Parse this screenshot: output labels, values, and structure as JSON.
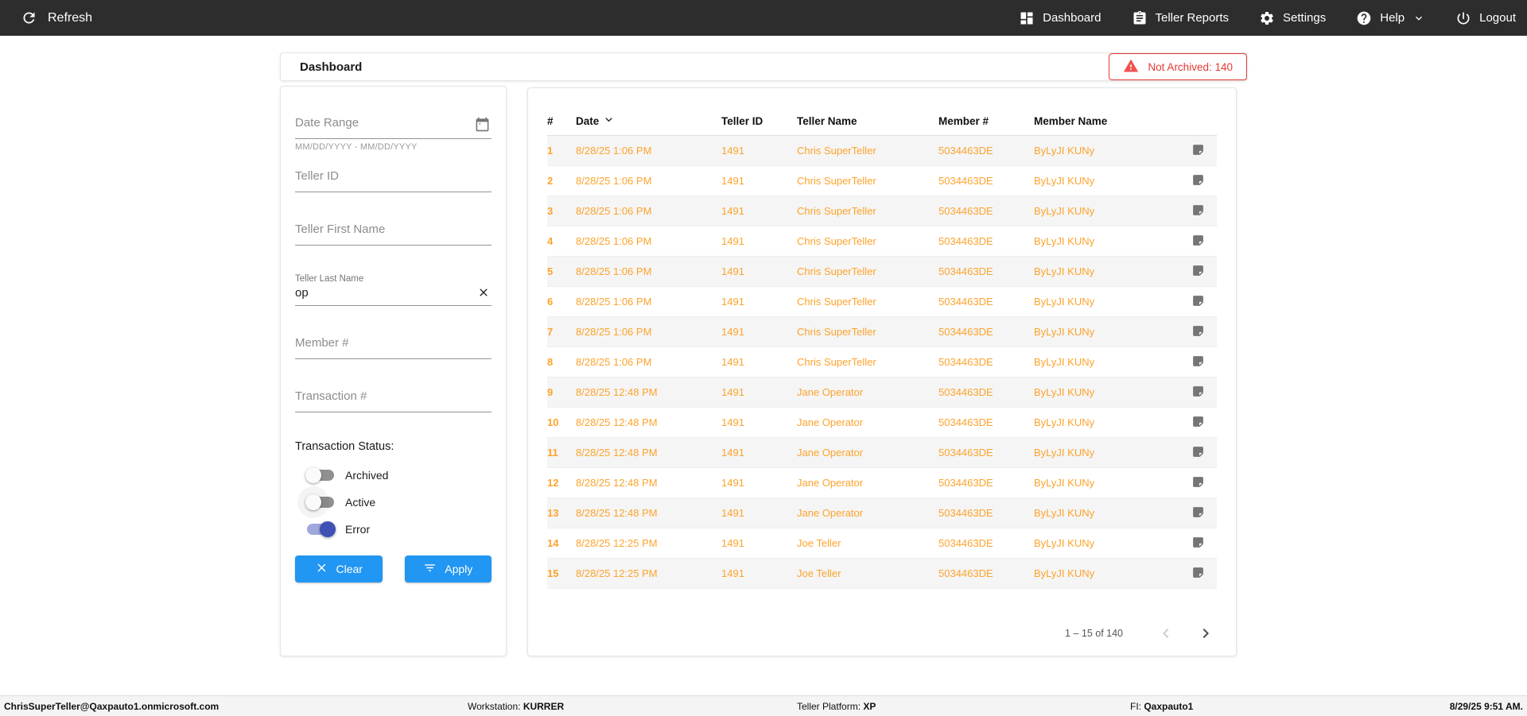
{
  "nav": {
    "refresh_label": "Refresh",
    "items": [
      {
        "label": "Dashboard",
        "icon": "dashboard-icon"
      },
      {
        "label": "Teller Reports",
        "icon": "teller-reports-icon"
      },
      {
        "label": "Settings",
        "icon": "settings-icon"
      },
      {
        "label": "Help",
        "icon": "help-icon",
        "has_dropdown": true
      },
      {
        "label": "Logout",
        "icon": "logout-icon"
      }
    ]
  },
  "header": {
    "title": "Dashboard",
    "badge_label": "Not Archived: 140"
  },
  "filters": {
    "date_range": {
      "placeholder": "Date Range",
      "hint": "MM/DD/YYYY - MM/DD/YYYY",
      "value": ""
    },
    "teller_id": {
      "placeholder": "Teller ID",
      "value": ""
    },
    "teller_first_name": {
      "placeholder": "Teller First Name",
      "value": ""
    },
    "teller_last_name": {
      "label": "Teller Last Name",
      "value": "op"
    },
    "member_number": {
      "placeholder": "Member #",
      "value": ""
    },
    "transaction_number": {
      "placeholder": "Transaction #",
      "value": ""
    },
    "status": {
      "label": "Transaction Status:",
      "toggles": [
        {
          "label": "Archived",
          "on": false
        },
        {
          "label": "Active",
          "on": false
        },
        {
          "label": "Error",
          "on": true
        }
      ]
    },
    "clear_label": "Clear",
    "apply_label": "Apply"
  },
  "table": {
    "columns": [
      "#",
      "Date",
      "Teller ID",
      "Teller Name",
      "Member #",
      "Member Name"
    ],
    "sort_column": "Date",
    "sort_direction": "desc",
    "rows": [
      {
        "num": "1",
        "date": "8/28/25 1:06 PM",
        "teller_id": "1491",
        "teller_name": "Chris SuperTeller",
        "member_num": "5034463DE",
        "member_name": "ByLyJI KUNy"
      },
      {
        "num": "2",
        "date": "8/28/25 1:06 PM",
        "teller_id": "1491",
        "teller_name": "Chris SuperTeller",
        "member_num": "5034463DE",
        "member_name": "ByLyJI KUNy"
      },
      {
        "num": "3",
        "date": "8/28/25 1:06 PM",
        "teller_id": "1491",
        "teller_name": "Chris SuperTeller",
        "member_num": "5034463DE",
        "member_name": "ByLyJI KUNy"
      },
      {
        "num": "4",
        "date": "8/28/25 1:06 PM",
        "teller_id": "1491",
        "teller_name": "Chris SuperTeller",
        "member_num": "5034463DE",
        "member_name": "ByLyJI KUNy"
      },
      {
        "num": "5",
        "date": "8/28/25 1:06 PM",
        "teller_id": "1491",
        "teller_name": "Chris SuperTeller",
        "member_num": "5034463DE",
        "member_name": "ByLyJI KUNy"
      },
      {
        "num": "6",
        "date": "8/28/25 1:06 PM",
        "teller_id": "1491",
        "teller_name": "Chris SuperTeller",
        "member_num": "5034463DE",
        "member_name": "ByLyJI KUNy"
      },
      {
        "num": "7",
        "date": "8/28/25 1:06 PM",
        "teller_id": "1491",
        "teller_name": "Chris SuperTeller",
        "member_num": "5034463DE",
        "member_name": "ByLyJI KUNy"
      },
      {
        "num": "8",
        "date": "8/28/25 1:06 PM",
        "teller_id": "1491",
        "teller_name": "Chris SuperTeller",
        "member_num": "5034463DE",
        "member_name": "ByLyJI KUNy"
      },
      {
        "num": "9",
        "date": "8/28/25 12:48 PM",
        "teller_id": "1491",
        "teller_name": "Jane Operator",
        "member_num": "5034463DE",
        "member_name": "ByLyJI KUNy"
      },
      {
        "num": "10",
        "date": "8/28/25 12:48 PM",
        "teller_id": "1491",
        "teller_name": "Jane Operator",
        "member_num": "5034463DE",
        "member_name": "ByLyJI KUNy"
      },
      {
        "num": "11",
        "date": "8/28/25 12:48 PM",
        "teller_id": "1491",
        "teller_name": "Jane Operator",
        "member_num": "5034463DE",
        "member_name": "ByLyJI KUNy"
      },
      {
        "num": "12",
        "date": "8/28/25 12:48 PM",
        "teller_id": "1491",
        "teller_name": "Jane Operator",
        "member_num": "5034463DE",
        "member_name": "ByLyJI KUNy"
      },
      {
        "num": "13",
        "date": "8/28/25 12:48 PM",
        "teller_id": "1491",
        "teller_name": "Jane Operator",
        "member_num": "5034463DE",
        "member_name": "ByLyJI KUNy"
      },
      {
        "num": "14",
        "date": "8/28/25 12:25 PM",
        "teller_id": "1491",
        "teller_name": "Joe Teller",
        "member_num": "5034463DE",
        "member_name": "ByLyJI KUNy"
      },
      {
        "num": "15",
        "date": "8/28/25 12:25 PM",
        "teller_id": "1491",
        "teller_name": "Joe Teller",
        "member_num": "5034463DE",
        "member_name": "ByLyJI KUNy"
      }
    ],
    "row_icon": "note-icon",
    "pagination": {
      "range_label": "1 – 15 of 140",
      "prev_enabled": false,
      "next_enabled": true
    }
  },
  "footer": {
    "user": "ChrisSuperTeller@Qaxpauto1.onmicrosoft.com",
    "workstation_label": "Workstation:",
    "workstation_value": "KURRER",
    "platform_label": "Teller Platform:",
    "platform_value": "XP",
    "fi_label": "FI:",
    "fi_value": "Qaxpauto1",
    "datetime": "8/29/25 9:51 AM."
  },
  "colors": {
    "nav_bg": "#2d2d2d",
    "accent_blue": "#2196f3",
    "row_orange": "#fda32c",
    "alert_red": "#e53935",
    "toggle_on": "#3f51b5",
    "toggle_on_track": "#9fa8da"
  }
}
